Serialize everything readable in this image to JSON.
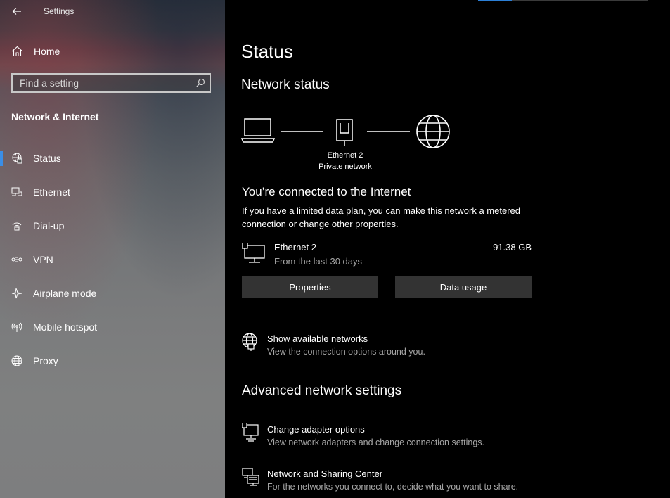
{
  "window": {
    "title": "Settings"
  },
  "sidebar": {
    "home_label": "Home",
    "search": {
      "placeholder": "Find a setting",
      "value": ""
    },
    "section_title": "Network & Internet",
    "items": [
      {
        "label": "Status",
        "icon": "globe-network-icon",
        "active": true
      },
      {
        "label": "Ethernet",
        "icon": "ethernet-icon",
        "active": false
      },
      {
        "label": "Dial-up",
        "icon": "dialup-icon",
        "active": false
      },
      {
        "label": "VPN",
        "icon": "vpn-icon",
        "active": false
      },
      {
        "label": "Airplane mode",
        "icon": "airplane-icon",
        "active": false
      },
      {
        "label": "Mobile hotspot",
        "icon": "hotspot-icon",
        "active": false
      },
      {
        "label": "Proxy",
        "icon": "globe-icon",
        "active": false
      }
    ]
  },
  "main": {
    "title": "Status",
    "network_status_heading": "Network status",
    "diagram": {
      "network_name": "Ethernet 2",
      "network_type": "Private network"
    },
    "connected_title": "You’re connected to the Internet",
    "connected_desc": "If you have a limited data plan, you can make this network a metered connection or change other properties.",
    "adapter": {
      "name": "Ethernet 2",
      "period": "From the last 30 days",
      "usage": "91.38 GB"
    },
    "buttons": {
      "properties": "Properties",
      "data_usage": "Data usage"
    },
    "show_networks": {
      "title": "Show available networks",
      "subtitle": "View the connection options around you."
    },
    "advanced_heading": "Advanced network settings",
    "change_adapter": {
      "title": "Change adapter options",
      "subtitle": "View network adapters and change connection settings."
    },
    "sharing_center": {
      "title": "Network and Sharing Center",
      "subtitle": "For the networks you connect to, decide what you want to share."
    }
  },
  "colors": {
    "accent": "#3a8ee6",
    "button_bg": "#333333",
    "secondary_text": "#a6a6a6",
    "main_bg": "#000000"
  }
}
